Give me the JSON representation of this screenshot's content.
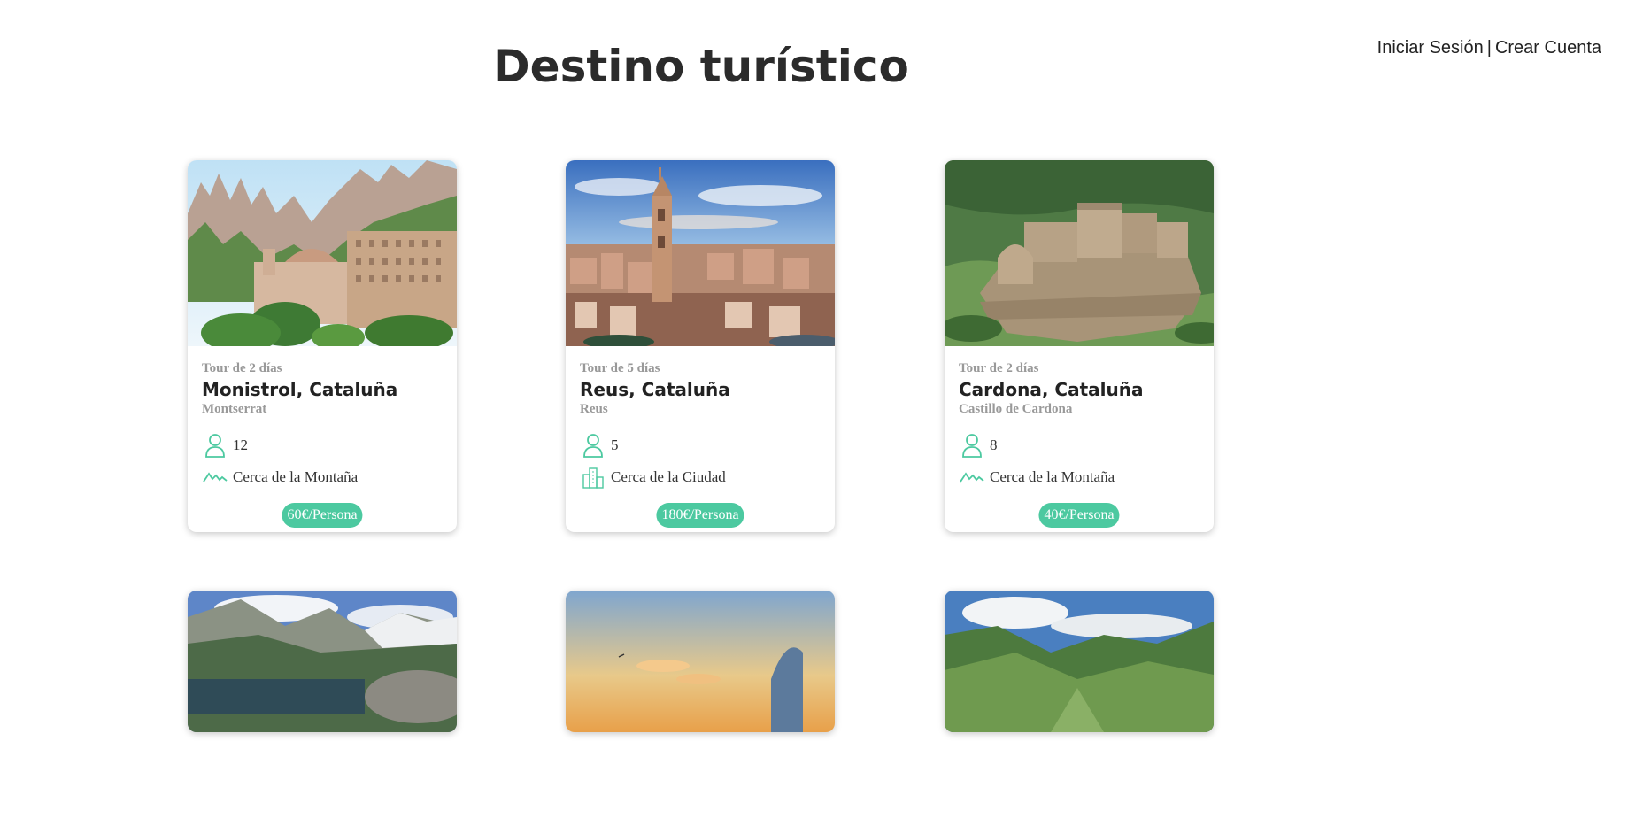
{
  "header": {
    "title": "Destino turístico",
    "login_label": "Iniciar Sesión",
    "separator": "|",
    "register_label": "Crear Cuenta"
  },
  "accent_color": "#4cc9a0",
  "cards": [
    {
      "duration": "Tour de 2 días",
      "name": "Monistrol, Cataluña",
      "sub": "Montserrat",
      "people": "12",
      "place_type": "Cerca de la Montaña",
      "place_icon": "mountain-icon",
      "price": "60€/Persona"
    },
    {
      "duration": "Tour de 5 días",
      "name": "Reus, Cataluña",
      "sub": "Reus",
      "people": "5",
      "place_type": "Cerca de la Ciudad",
      "place_icon": "city-icon",
      "price": "180€/Persona"
    },
    {
      "duration": "Tour de 2 días",
      "name": "Cardona, Cataluña",
      "sub": "Castillo de Cardona",
      "people": "8",
      "place_type": "Cerca de la Montaña",
      "place_icon": "mountain-icon",
      "price": "40€/Persona"
    }
  ]
}
